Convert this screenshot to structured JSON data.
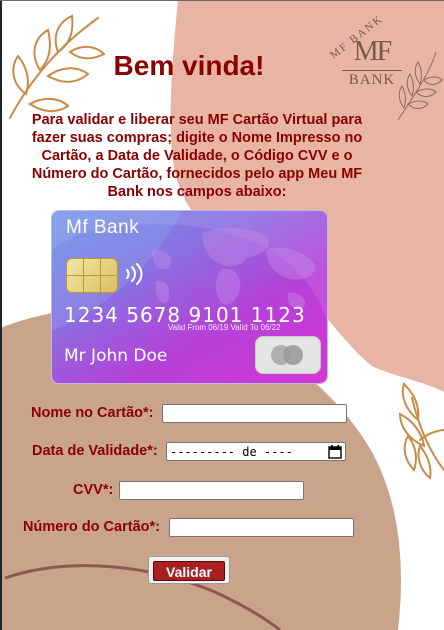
{
  "logo": {
    "arc_text": "MF BANK",
    "mark": "MF",
    "bank": "BANK"
  },
  "heading": "Bem vinda!",
  "intro": "Para validar e liberar seu MF Cartão Virtual para fazer suas compras; digite o Nome Impresso no Cartão, a Data de Validade, o Código CVV e o Número do Cartão, fornecidos pelo app Meu MF Bank nos campos abaixo:",
  "card": {
    "brand": "Mf Bank",
    "number": "1234 5678 9101 1123",
    "valid": "Valid From 06/19  Valid To 06/22",
    "holder": "Mr John Doe"
  },
  "form": {
    "name_label": "Nome no Cartão*:",
    "name_value": "",
    "date_label": "Data de Validade*:",
    "date_display": "--------- de ----",
    "cvv_label": "CVV*:",
    "cvv_value": "",
    "number_label": "Número do Cartão*:",
    "number_value": ""
  },
  "submit_label": "Validar",
  "colors": {
    "accent": "#8b0000",
    "blob_pink": "#e8b4a4",
    "blob_tan": "#c9a48a",
    "leaf": "#c98a4a",
    "button": "#a82020"
  }
}
